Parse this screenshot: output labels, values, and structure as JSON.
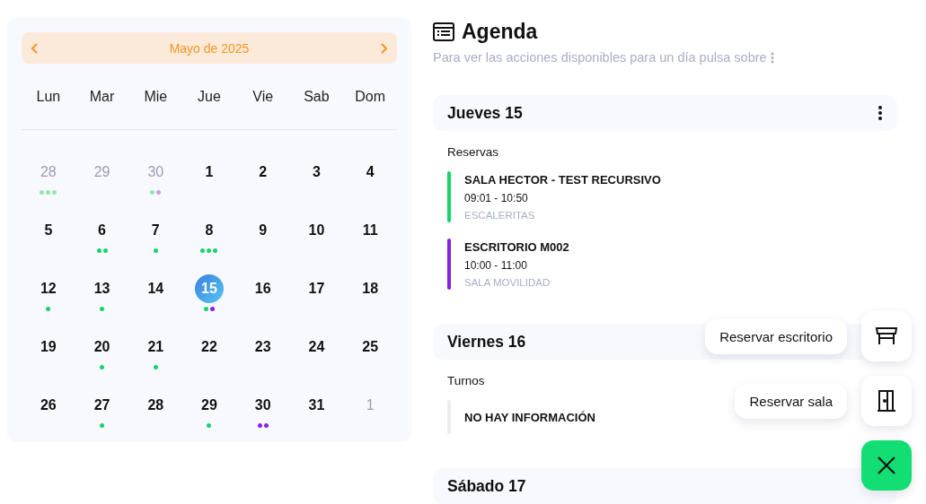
{
  "calendar": {
    "month": "Mayo de 2025",
    "weekdays": [
      "Lun",
      "Mar",
      "Mie",
      "Jue",
      "Vie",
      "Sab",
      "Dom"
    ],
    "days": [
      {
        "day": "28",
        "outside": true,
        "selected": false,
        "dots": [
          {
            "color": "#8ee8b1"
          },
          {
            "color": "#8ee8b1"
          },
          {
            "color": "#8ee8b1"
          }
        ]
      },
      {
        "day": "29",
        "outside": true,
        "selected": false
      },
      {
        "day": "30",
        "outside": true,
        "selected": false,
        "dots": [
          {
            "color": "#8ee8b1"
          },
          {
            "color": "#c99af0"
          }
        ]
      },
      {
        "day": "1",
        "outside": false,
        "selected": false
      },
      {
        "day": "2",
        "outside": false,
        "selected": false
      },
      {
        "day": "3",
        "outside": false,
        "selected": false
      },
      {
        "day": "4",
        "outside": false,
        "selected": false
      },
      {
        "day": "5",
        "outside": false,
        "selected": false
      },
      {
        "day": "6",
        "outside": false,
        "selected": false,
        "dots": [
          {
            "color": "#17d46b"
          },
          {
            "color": "#17d46b"
          }
        ]
      },
      {
        "day": "7",
        "outside": false,
        "selected": false,
        "dots": [
          {
            "color": "#17d46b"
          }
        ]
      },
      {
        "day": "8",
        "outside": false,
        "selected": false,
        "dots": [
          {
            "color": "#17d46b"
          },
          {
            "color": "#17d46b"
          },
          {
            "color": "#17d46b"
          }
        ]
      },
      {
        "day": "9",
        "outside": false,
        "selected": false
      },
      {
        "day": "10",
        "outside": false,
        "selected": false
      },
      {
        "day": "11",
        "outside": false,
        "selected": false
      },
      {
        "day": "12",
        "outside": false,
        "selected": false,
        "dots": [
          {
            "color": "#17d46b"
          }
        ]
      },
      {
        "day": "13",
        "outside": false,
        "selected": false,
        "dots": [
          {
            "color": "#17d46b"
          }
        ]
      },
      {
        "day": "14",
        "outside": false,
        "selected": false
      },
      {
        "day": "15",
        "outside": false,
        "selected": true,
        "dots": [
          {
            "color": "#17d46b"
          },
          {
            "color": "#8a1ee8"
          }
        ]
      },
      {
        "day": "16",
        "outside": false,
        "selected": false
      },
      {
        "day": "17",
        "outside": false,
        "selected": false
      },
      {
        "day": "18",
        "outside": false,
        "selected": false
      },
      {
        "day": "19",
        "outside": false,
        "selected": false
      },
      {
        "day": "20",
        "outside": false,
        "selected": false,
        "dots": [
          {
            "color": "#17d46b"
          }
        ]
      },
      {
        "day": "21",
        "outside": false,
        "selected": false,
        "dots": [
          {
            "color": "#17d46b"
          }
        ]
      },
      {
        "day": "22",
        "outside": false,
        "selected": false
      },
      {
        "day": "23",
        "outside": false,
        "selected": false
      },
      {
        "day": "24",
        "outside": false,
        "selected": false
      },
      {
        "day": "25",
        "outside": false,
        "selected": false
      },
      {
        "day": "26",
        "outside": false,
        "selected": false
      },
      {
        "day": "27",
        "outside": false,
        "selected": false,
        "dots": [
          {
            "color": "#17d46b"
          }
        ]
      },
      {
        "day": "28",
        "outside": false,
        "selected": false
      },
      {
        "day": "29",
        "outside": false,
        "selected": false,
        "dots": [
          {
            "color": "#17d46b"
          }
        ]
      },
      {
        "day": "30",
        "outside": false,
        "selected": false,
        "dots": [
          {
            "color": "#8a1ee8"
          },
          {
            "color": "#8a1ee8"
          }
        ]
      },
      {
        "day": "31",
        "outside": false,
        "selected": false
      },
      {
        "day": "1",
        "outside": true,
        "selected": false
      }
    ]
  },
  "agenda": {
    "title": "Agenda",
    "hint": "Para ver las acciones disponibles para un día pulsa sobre",
    "days": [
      {
        "title": "Jueves 15",
        "menu": true,
        "sections": [
          {
            "label": "Reservas",
            "entries": [
              {
                "kind": "booking",
                "color": "#17d46b",
                "name": "SALA HECTOR - TEST RECURSIVO",
                "time": "09:01 - 10:50",
                "place": "ESCALERITAS"
              },
              {
                "kind": "booking",
                "color": "#8a1ee8",
                "name": "ESCRITORIO M002",
                "time": "10:00 - 11:00",
                "place": "SALA MOVILIDAD"
              }
            ]
          }
        ]
      },
      {
        "title": "Viernes 16",
        "sections": [
          {
            "label": "Turnos",
            "entries": [
              {
                "kind": "empty",
                "name": "NO HAY INFORMACIÓN"
              }
            ]
          }
        ]
      },
      {
        "title": "Sábado 17"
      }
    ]
  },
  "fab": {
    "open": true,
    "actions": [
      {
        "label": "Reservar escritorio",
        "kind": "desk"
      },
      {
        "label": "Reservar sala",
        "kind": "door"
      }
    ]
  }
}
